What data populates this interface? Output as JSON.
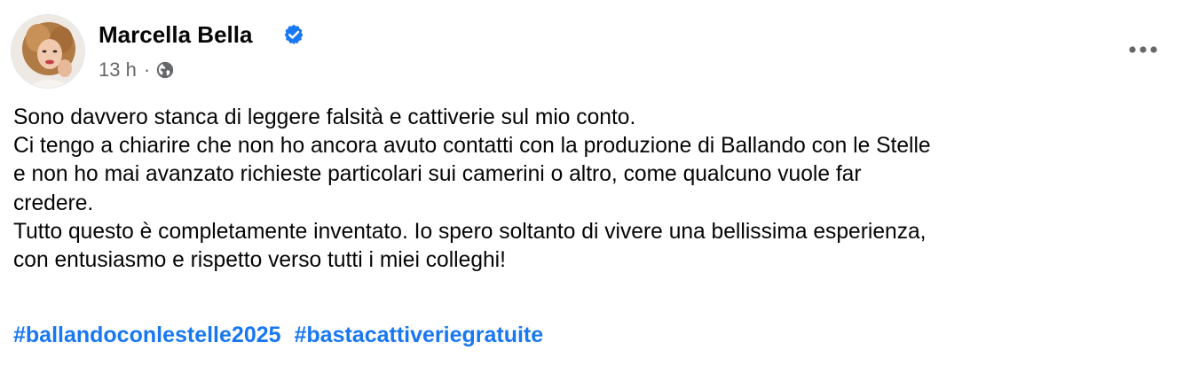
{
  "post": {
    "author": {
      "name": "Marcella Bella",
      "verified": true,
      "avatar_icon": "profile-photo"
    },
    "timestamp": "13 h",
    "separator": "·",
    "audience_icon": "globe-icon",
    "more_icon": "three-dots-icon",
    "body_lines": [
      "Sono davvero stanca di leggere falsità e cattiverie sul mio conto.",
      "Ci tengo a chiarire che non ho ancora avuto contatti con la produzione di Ballando con le Stelle",
      "e non ho mai avanzato richieste particolari sui camerini o altro, come qualcuno vuole far",
      "credere.",
      "Tutto questo è completamente inventato. Io spero soltanto di vivere una bellissima esperienza,",
      "con entusiasmo e rispetto verso tutti i miei colleghi!"
    ],
    "hashtags": [
      "#ballandoconlestelle2025",
      "#bastacattiveriegratuite"
    ]
  },
  "colors": {
    "text": "#050505",
    "secondary_text": "#65676b",
    "link": "#1877f2",
    "verified_badge": "#1877f2",
    "background": "#ffffff"
  }
}
